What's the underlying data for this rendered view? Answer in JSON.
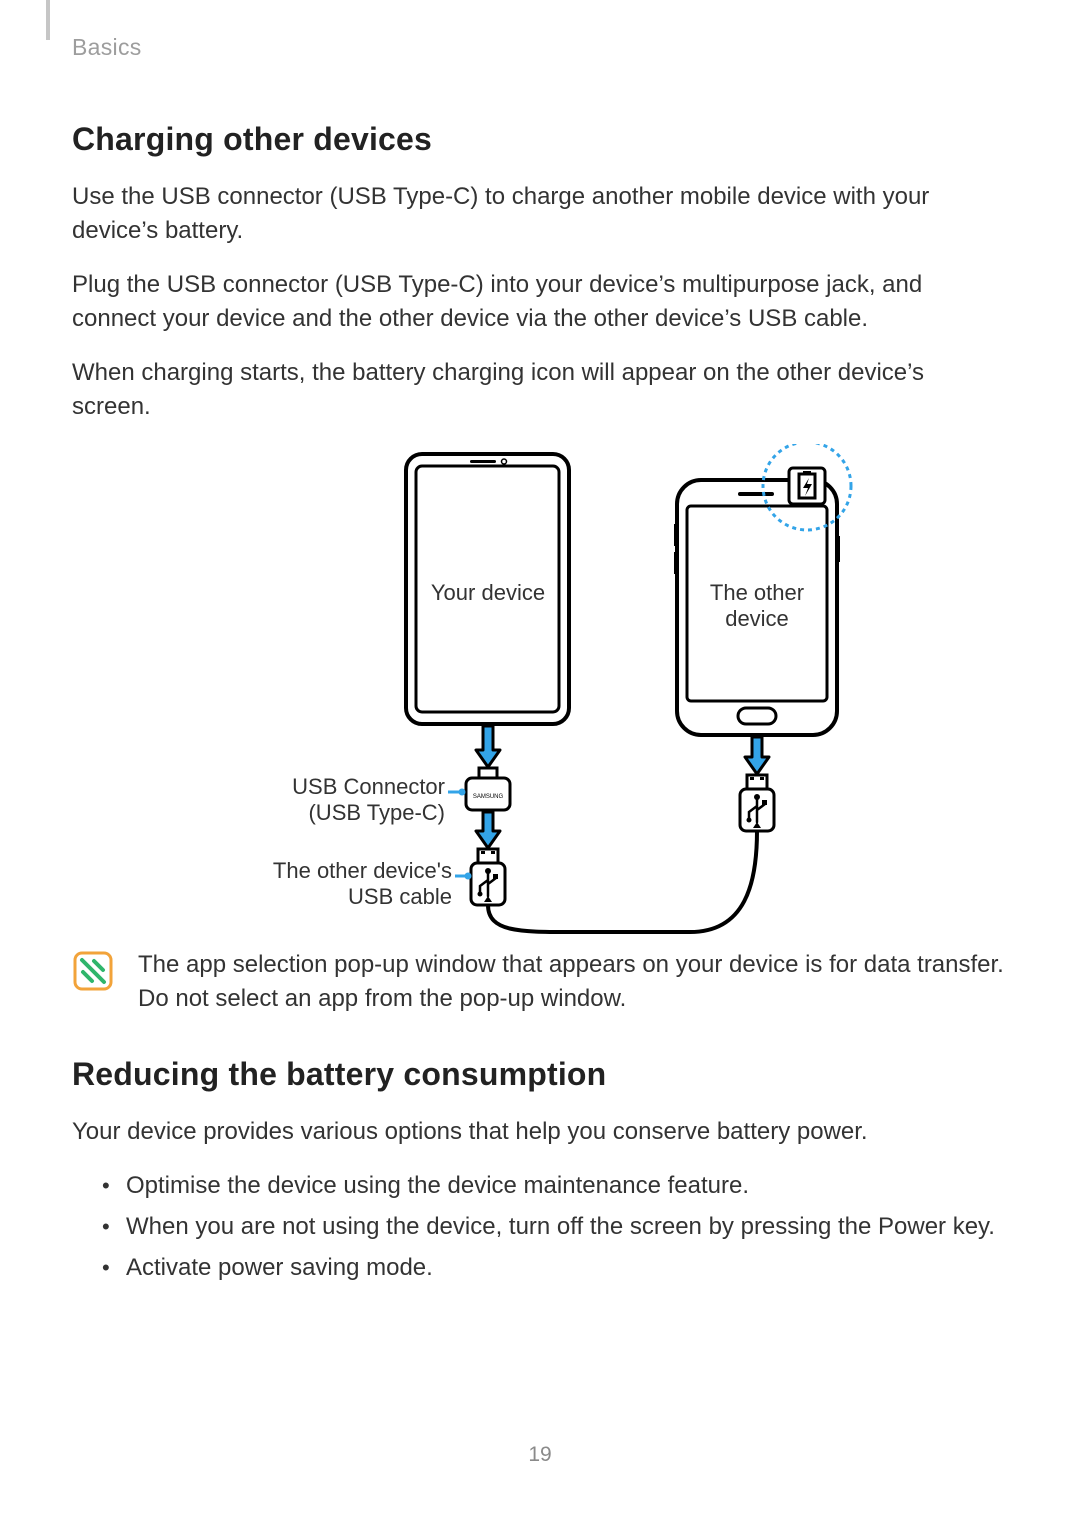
{
  "breadcrumb": "Basics",
  "page_number": "19",
  "section1": {
    "heading": "Charging other devices",
    "para1": "Use the USB connector (USB Type-C) to charge another mobile device with your device’s battery.",
    "para2": "Plug the USB connector (USB Type-C) into your device’s multipurpose jack, and connect your device and the other device via the other device’s USB cable.",
    "para3": "When charging starts, the battery charging icon will appear on the other device’s screen."
  },
  "diagram": {
    "your_device": "Your device",
    "other_device_line1": "The other",
    "other_device_line2": "device",
    "usb_connector_line1": "USB Connector",
    "usb_connector_line2": "(USB Type-C)",
    "other_cable_line1": "The other device's",
    "other_cable_line2": "USB cable"
  },
  "note_text": "The app selection pop-up window that appears on your device is for data transfer. Do not select an app from the pop-up window.",
  "section2": {
    "heading": "Reducing the battery consumption",
    "intro": "Your device provides various options that help you conserve battery power.",
    "bullets": [
      "Optimise the device using the device maintenance feature.",
      "When you are not using the device, turn off the screen by pressing the Power key.",
      "Activate power saving mode."
    ]
  }
}
